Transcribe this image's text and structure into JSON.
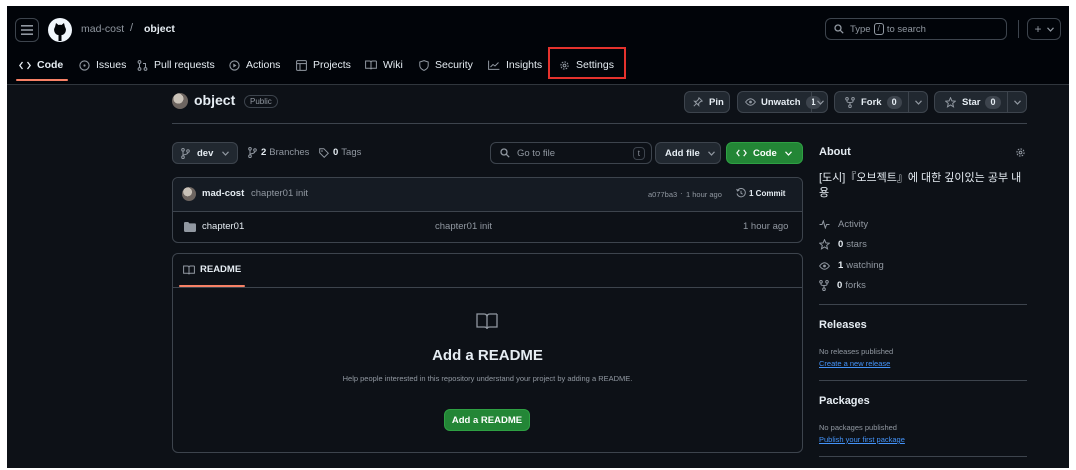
{
  "header": {
    "owner": "mad-cost",
    "separator": "/",
    "repo": "object",
    "search_placeholder": "Type",
    "search_key": "/",
    "search_suffix": "to search",
    "plus": "+"
  },
  "tabs": [
    {
      "label": "Code"
    },
    {
      "label": "Issues"
    },
    {
      "label": "Pull requests"
    },
    {
      "label": "Actions"
    },
    {
      "label": "Projects"
    },
    {
      "label": "Wiki"
    },
    {
      "label": "Security"
    },
    {
      "label": "Insights"
    },
    {
      "label": "Settings"
    }
  ],
  "repo": {
    "name": "object",
    "visibility": "Public",
    "pin": "Pin",
    "unwatch": "Unwatch",
    "watch_count": "1",
    "fork": "Fork",
    "fork_count": "0",
    "star": "Star",
    "star_count": "0"
  },
  "toolbar": {
    "branch": "dev",
    "branches_count": "2",
    "branches_label": "Branches",
    "tags_count": "0",
    "tags_label": "Tags",
    "go_to_file": "Go to file",
    "go_to_key": "t",
    "add_file": "Add file",
    "code": "Code"
  },
  "commit": {
    "author": "mad-cost",
    "message": "chapter01 init",
    "hash": "a077ba3",
    "dot": "·",
    "time": "1 hour ago",
    "commits_label": "1 Commit"
  },
  "files": [
    {
      "name": "chapter01",
      "message": "chapter01 init",
      "time": "1 hour ago"
    }
  ],
  "readme": {
    "tab": "README",
    "title": "Add a README",
    "description": "Help people interested in this repository understand your project by adding a README.",
    "button": "Add a README"
  },
  "about": {
    "heading": "About",
    "description": "[도시]『오브젝트』에 대한 깊이있는 공부 내용",
    "activity": "Activity",
    "stars_count": "0",
    "stars_label": "stars",
    "watching_count": "1",
    "watching_label": "watching",
    "forks_count": "0",
    "forks_label": "forks"
  },
  "releases": {
    "heading": "Releases",
    "text": "No releases published",
    "link": "Create a new release"
  },
  "packages": {
    "heading": "Packages",
    "text": "No packages published",
    "link": "Publish your first package"
  },
  "colors": {
    "background": "#0d1117",
    "header": "#010409",
    "accent_green": "#238636",
    "tab_underline": "#f78166",
    "highlight": "#e5322d",
    "link": "#4493f8"
  }
}
